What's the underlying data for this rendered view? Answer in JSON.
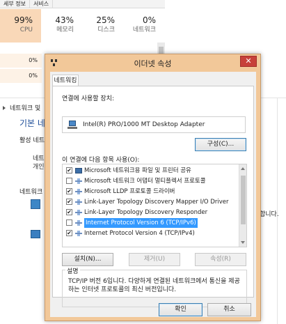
{
  "background": {
    "tabs": [
      "세부 정보",
      "서비스"
    ],
    "perf": [
      {
        "pct": "99%",
        "name": "CPU"
      },
      {
        "pct": "43%",
        "name": "메모리"
      },
      {
        "pct": "25%",
        "name": "디스크"
      },
      {
        "pct": "0%",
        "name": "네트워크"
      }
    ],
    "cells": [
      "0%",
      "0%"
    ],
    "nav_label": "네트워크 및",
    "title": "기본 네",
    "active_net": "활성 네트",
    "net_label": "네트워",
    "net_sub": "개인",
    "net_change": "네트워크",
    "right_text": "합니다."
  },
  "dialog": {
    "title": "이더넷 속성",
    "close_label": "✕",
    "tab_label": "네트워킹",
    "connect_using_label": "연결에 사용할 장치:",
    "adapter_name": "Intel(R) PRO/1000 MT Desktop Adapter",
    "configure_label": "구성(C)...",
    "items_label": "이 연결에 다음 항목 사용(O):",
    "items": [
      {
        "label": "Microsoft 네트워크용 파일 및 프린터 공유",
        "checked": true,
        "icon": "share-icon"
      },
      {
        "label": "Microsoft 네트워크 어댑터 멀티플렉서 프로토콜",
        "checked": false,
        "icon": "protocol-icon"
      },
      {
        "label": "Microsoft LLDP 프로토콜 드라이버",
        "checked": true,
        "icon": "protocol-icon"
      },
      {
        "label": "Link-Layer Topology Discovery Mapper I/O Driver",
        "checked": true,
        "icon": "protocol-icon"
      },
      {
        "label": "Link-Layer Topology Discovery Responder",
        "checked": true,
        "icon": "protocol-icon"
      },
      {
        "label": "Internet Protocol Version 6 (TCP/IPv6)",
        "checked": false,
        "icon": "protocol-icon",
        "selected": true
      },
      {
        "label": "Internet Protocol Version 4 (TCP/IPv4)",
        "checked": true,
        "icon": "protocol-icon"
      }
    ],
    "install_label": "설치(N)...",
    "uninstall_label": "제거(U)",
    "properties_label": "속성(R)",
    "description_title": "설명",
    "description_text": "TCP/IP 버전 6입니다. 다양하게 연결된 네트워크에서 통신을 제공하는 인터넷 프로토콜의 최신 버전입니다.",
    "ok_label": "확인",
    "cancel_label": "취소",
    "colors": {
      "frame": "#f2c899",
      "selection": "#3399ff",
      "close": "#c7413a"
    }
  }
}
